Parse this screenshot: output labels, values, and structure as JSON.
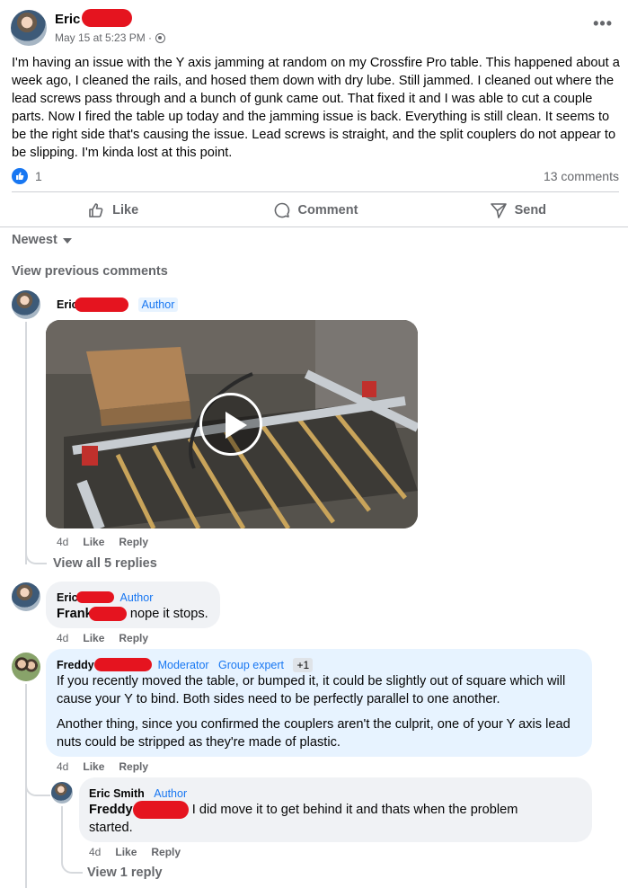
{
  "post": {
    "author": "Eric",
    "time": "May 15 at 5:23 PM ·",
    "more_icon": "•••",
    "body": "I'm having an issue with the Y axis jamming at random on my Crossfire Pro table. This happened about a week ago, I cleaned the rails, and hosed them down with dry lube. Still jammed. I cleaned out where the lead screws pass through and a bunch of gunk came out. That fixed it and I was able to cut a couple parts. Now I fired the table up today and the jamming issue is back. Everything is still clean. It seems to be the right side that's causing the issue. Lead screws is straight, and the split couplers do not appear to be slipping. I'm kinda lost at this point.",
    "reaction_count": "1",
    "comments_count": "13 comments"
  },
  "actions": {
    "like": "Like",
    "comment": "Comment",
    "send": "Send"
  },
  "sort_label": "Newest",
  "view_previous": "View previous comments",
  "comments": {
    "c1": {
      "name": "Eric",
      "badge": "Author",
      "time": "4d",
      "like": "Like",
      "reply": "Reply",
      "view_replies": "View all 5 replies"
    },
    "c2": {
      "name": "Eric",
      "badge": "Author",
      "mention": "Frank",
      "text": "nope it stops.",
      "time": "4d",
      "like": "Like",
      "reply": "Reply"
    },
    "c3": {
      "name": "Freddy",
      "badge_moderator": "Moderator",
      "badge_expert": "Group expert",
      "badge_plus": "+1",
      "p1": "If you recently moved the table, or bumped it, it could be slightly out of square which will cause your Y to bind. Both sides need to be perfectly parallel to one another.",
      "p2": "Another thing, since you confirmed the couplers aren't the culprit, one of your Y axis lead nuts could be stripped as they're made of plastic.",
      "time": "4d",
      "like": "Like",
      "reply": "Reply"
    },
    "c4": {
      "name": "Eric Smith",
      "badge": "Author",
      "mention": "Freddy",
      "text": "I did move it to get behind it and thats when the problem started.",
      "time": "4d",
      "like": "Like",
      "reply": "Reply",
      "view_replies": "View 1 reply"
    }
  },
  "colors": {
    "accent": "#1877f2",
    "muted": "#65676b",
    "bubble": "#f0f2f5",
    "moderator_bubble": "#e7f3ff",
    "redaction": "#e5141f"
  }
}
